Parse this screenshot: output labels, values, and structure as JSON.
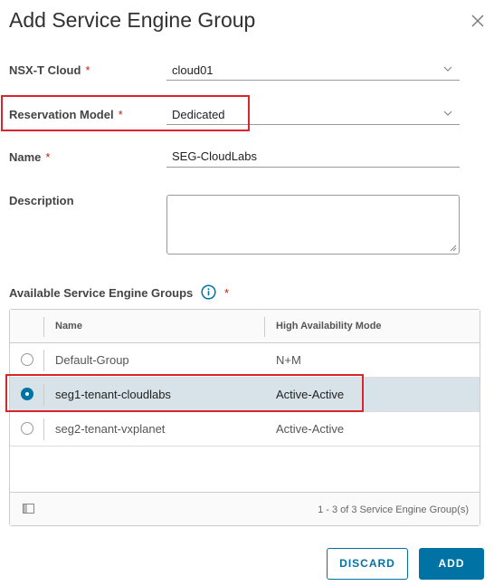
{
  "dialog": {
    "title": "Add Service Engine Group",
    "close_icon": "close-icon"
  },
  "form": {
    "required_marker": "*",
    "nsxt_cloud": {
      "label": "NSX-T Cloud",
      "value": "cloud01"
    },
    "reservation_model": {
      "label": "Reservation Model",
      "value": "Dedicated"
    },
    "name": {
      "label": "Name",
      "value": "SEG-CloudLabs"
    },
    "description": {
      "label": "Description",
      "value": ""
    },
    "available_groups_label": "Available Service Engine Groups"
  },
  "grid": {
    "columns": [
      "Name",
      "High Availability Mode"
    ],
    "rows": [
      {
        "name": "Default-Group",
        "ha_mode": "N+M",
        "selected": false
      },
      {
        "name": "seg1-tenant-cloudlabs",
        "ha_mode": "Active-Active",
        "selected": true
      },
      {
        "name": "seg2-tenant-vxplanet",
        "ha_mode": "Active-Active",
        "selected": false
      }
    ],
    "footer": "1 - 3 of 3 Service Engine Group(s)"
  },
  "buttons": {
    "discard": "DISCARD",
    "add": "ADD"
  },
  "colors": {
    "accent": "#0072a3",
    "highlight": "#d9262c",
    "selected_row": "#d8e3e9",
    "required": "#c92100"
  }
}
